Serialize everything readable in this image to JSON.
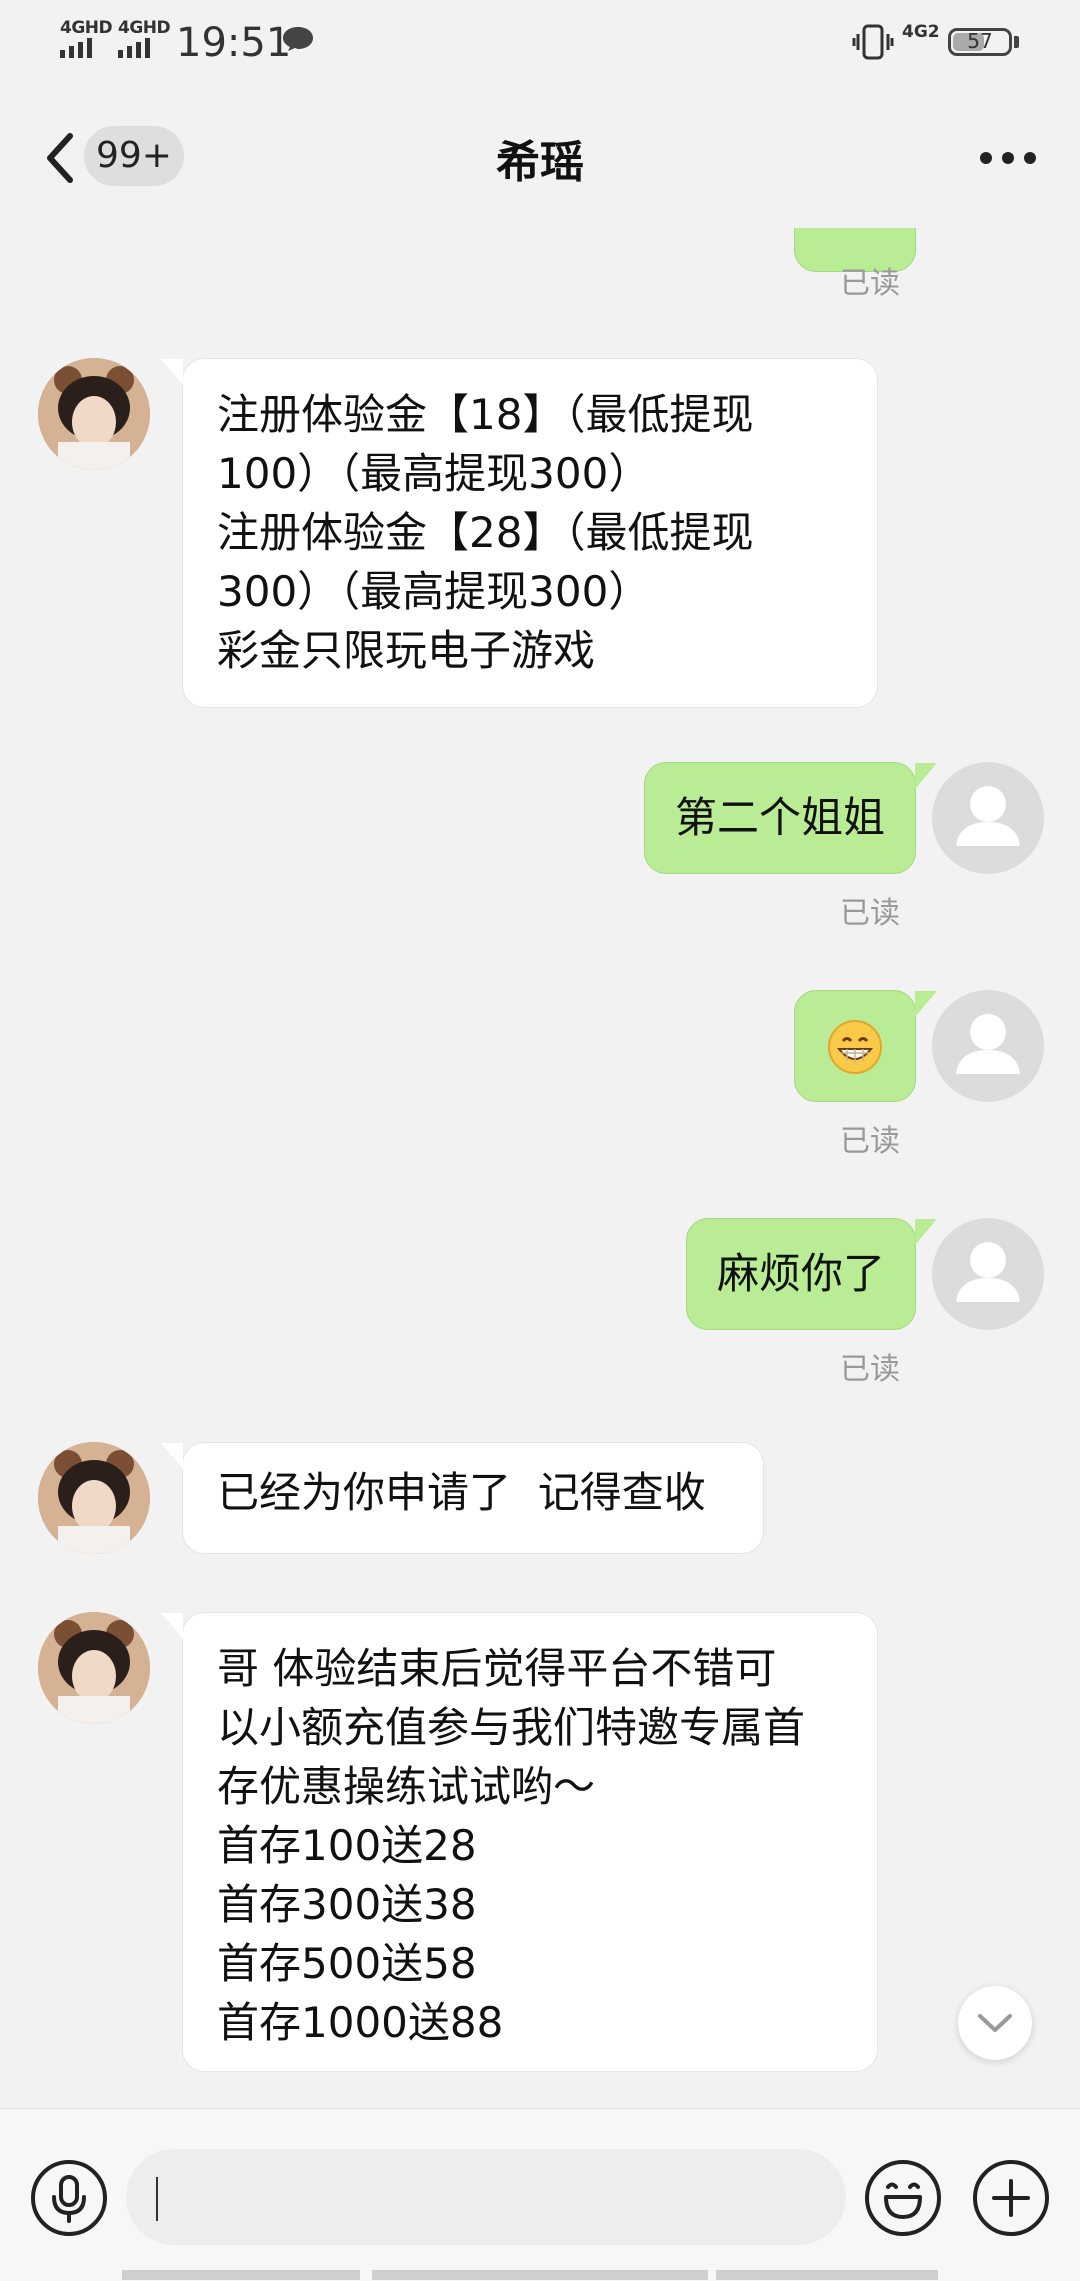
{
  "status_bar": {
    "network_1": "4GHD",
    "network_2": "4GHD",
    "time": "19:51",
    "network_3": "4G2",
    "battery": "57",
    "battery_level": 0.57
  },
  "header": {
    "unread_count": "99+",
    "title": "希瑶"
  },
  "messages": [
    {
      "side": "out",
      "read_label": "已读"
    },
    {
      "side": "in",
      "text": "注册体验金【18】（最低提现\n100）（最高提现300）\n注册体验金【28】（最低提现\n300）（最高提现300）\n彩金只限玩电子游戏"
    },
    {
      "side": "out",
      "text": "第二个姐姐",
      "read_label": "已读"
    },
    {
      "side": "out",
      "emoji": "grinning-face",
      "read_label": "已读"
    },
    {
      "side": "out",
      "text": "麻烦你了",
      "read_label": "已读"
    },
    {
      "side": "in",
      "text": "已经为你申请了  记得查收"
    },
    {
      "side": "in",
      "text": "哥 体验结束后觉得平台不错可\n以小额充值参与我们特邀专属首\n存优惠操练试试哟～\n首存100送28\n首存300送38\n首存500送58\n首存1000送88"
    }
  ],
  "input_bar": {
    "voice_icon": "microphone-icon",
    "emoji_icon": "emoji-icon",
    "plus_icon": "plus-icon"
  },
  "colors": {
    "outgoing_bubble": "#b9ec94",
    "incoming_bubble": "#ffffff",
    "background": "#f2f2f2"
  }
}
